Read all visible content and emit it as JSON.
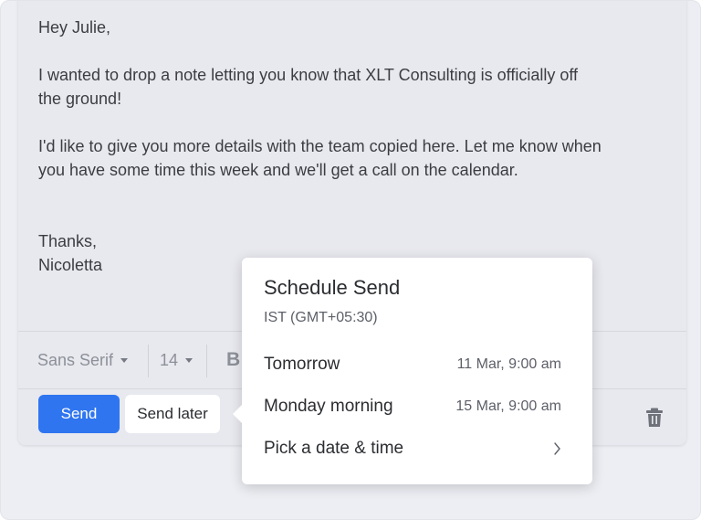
{
  "email": {
    "greeting": "Hey Julie,",
    "paragraph1_line1": "I wanted to drop a note letting you know that XLT Consulting is officially off",
    "paragraph1_line2": "the ground!",
    "paragraph2_line1": "I'd like to give you more details with the team copied here. Let me know when",
    "paragraph2_line2": "you have some time this week and we'll get a call on the calendar.",
    "closing": "Thanks,",
    "signature": "Nicoletta"
  },
  "toolbar": {
    "font_family": "Sans Serif",
    "font_size": "14",
    "bold_label": "B"
  },
  "actions": {
    "send_label": "Send",
    "send_later_label": "Send later",
    "delete_icon": "trash-icon"
  },
  "schedule_popover": {
    "title": "Schedule Send",
    "timezone": "IST (GMT+05:30)",
    "options": [
      {
        "label": "Tomorrow",
        "time": "11 Mar, 9:00 am"
      },
      {
        "label": "Monday morning",
        "time": "15 Mar, 9:00 am"
      },
      {
        "label": "Pick a date & time",
        "icon": "chevron-right-icon"
      }
    ]
  },
  "colors": {
    "accent": "#2f75f0",
    "background": "#eceef3",
    "compose_bg": "#e8e9ef",
    "text": "#3b3d42"
  }
}
